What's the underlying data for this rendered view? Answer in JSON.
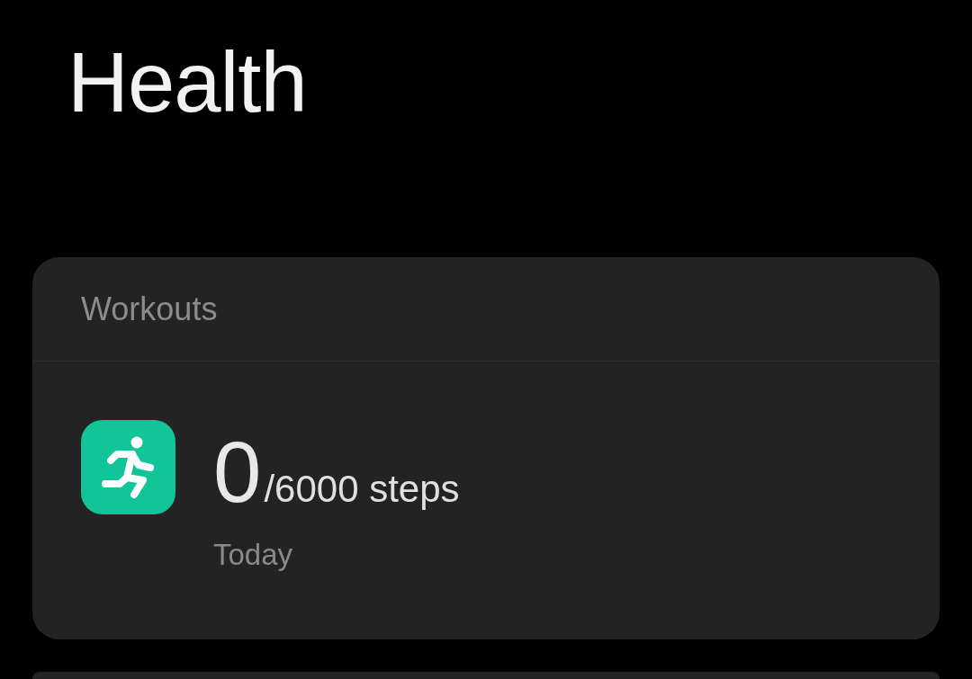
{
  "title": "Health",
  "workouts_card": {
    "title": "Workouts",
    "steps": {
      "value": "0",
      "goal": "/6000 steps",
      "period": "Today"
    }
  }
}
